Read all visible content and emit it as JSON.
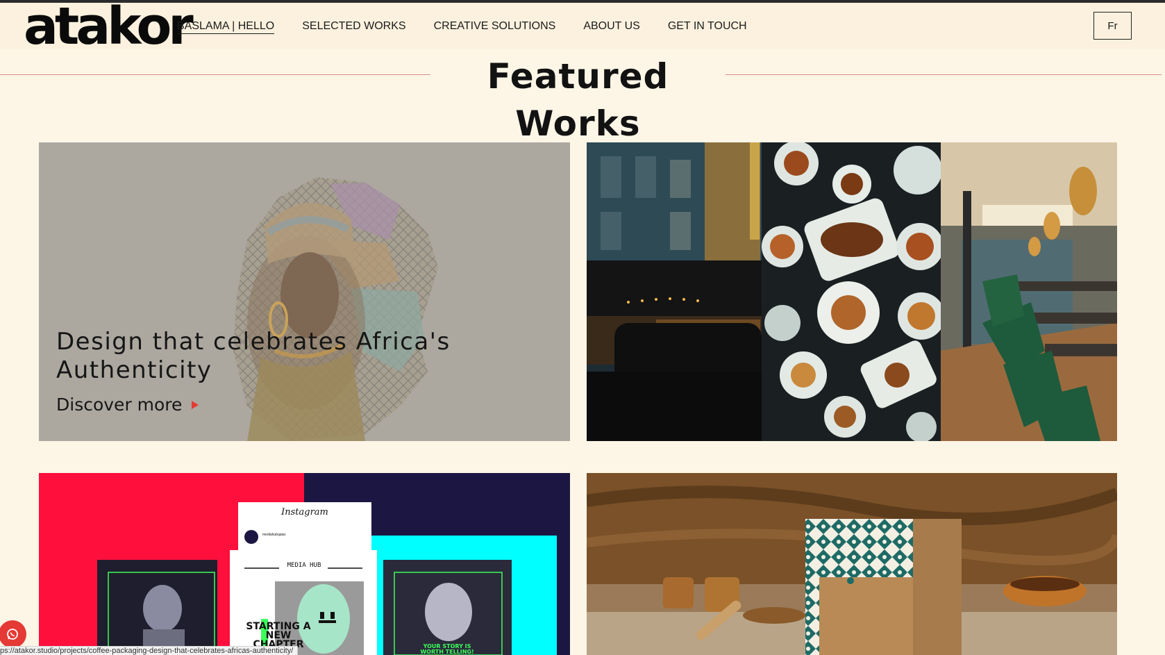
{
  "brand": {
    "logo_text": "atakor"
  },
  "nav": {
    "items": [
      {
        "label": "BASLAMA | HELLO"
      },
      {
        "label": "SELECTED WORKS"
      },
      {
        "label": "CREATIVE SOLUTIONS"
      },
      {
        "label": "ABOUT US"
      },
      {
        "label": "GET IN TOUCH"
      }
    ],
    "lang_button": "Fr"
  },
  "section": {
    "title": "Featured Works"
  },
  "cards": [
    {
      "title": "Design that celebrates Africa's Authenticity",
      "link_label": "Discover more"
    }
  ],
  "media_hub": {
    "instagram_label": "Instagram",
    "account_name": "mediahubqatar",
    "logo_text": "MEDIA HUB",
    "headline": "STARTING A NEW CHAPTER",
    "tagline": "YOUR STORY IS WORTH TELLING!"
  },
  "status_bar": {
    "url": "ps://atakor.studio/projects/coffee-packaging-design-that-celebrates-africas-authenticity/"
  },
  "colors": {
    "accent": "#e53935",
    "background": "#fdf6e7",
    "header": "#fbf1de"
  }
}
